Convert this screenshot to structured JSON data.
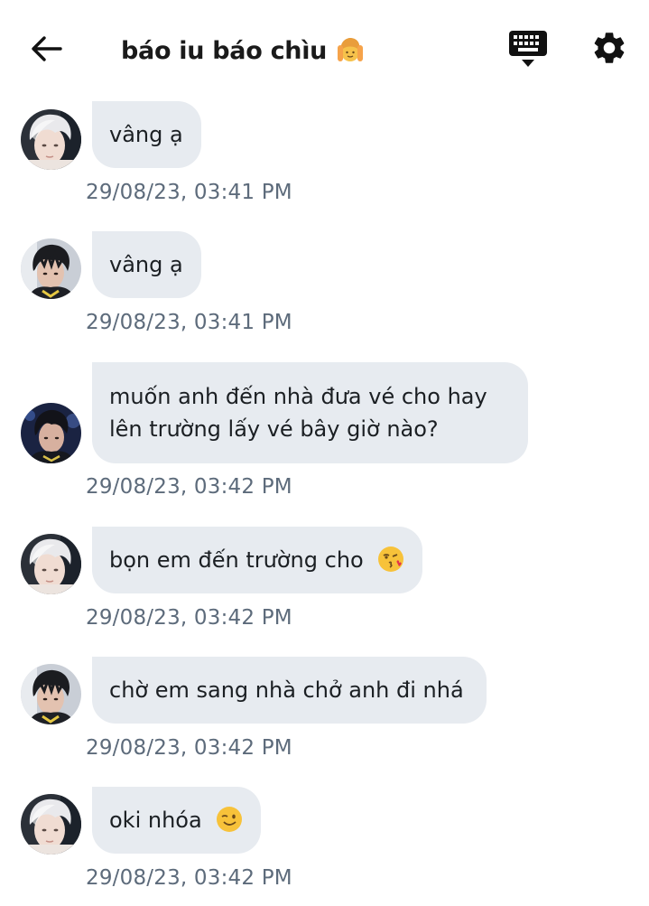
{
  "header": {
    "title": "báo iu báo chìu",
    "title_emoji": "hands-raised-person-emoji",
    "back_icon": "back-arrow-icon",
    "keyboard_icon": "keyboard-icon",
    "settings_icon": "gear-icon"
  },
  "messages": [
    {
      "avatar": "avatar-silver-hair",
      "text": "vâng ạ",
      "time": "29/08/23, 03:41 PM"
    },
    {
      "avatar": "avatar-dark-hair",
      "text": "vâng ạ",
      "time": "29/08/23, 03:41 PM"
    },
    {
      "avatar": "avatar-dark-hair-blue",
      "text_line1": "muốn anh đến nhà đưa vé cho hay",
      "text_line2": "lên trường lấy vé bây giờ nào?",
      "time": "29/08/23, 03:42 PM"
    },
    {
      "avatar": "avatar-silver-hair",
      "text": "bọn em đến trường cho",
      "emoji": "face-blowing-kiss-emoji",
      "time": "29/08/23, 03:42 PM"
    },
    {
      "avatar": "avatar-dark-hair",
      "text": "chờ em sang nhà chở anh đi nhá",
      "time": "29/08/23, 03:42 PM"
    },
    {
      "avatar": "avatar-silver-hair",
      "text": "oki nhóa",
      "emoji": "winking-face-emoji",
      "time": "29/08/23, 03:42 PM"
    }
  ],
  "colors": {
    "bubble_bg": "#e7ebf0",
    "timestamp": "#5d6b7b",
    "text": "#1b1f23"
  }
}
